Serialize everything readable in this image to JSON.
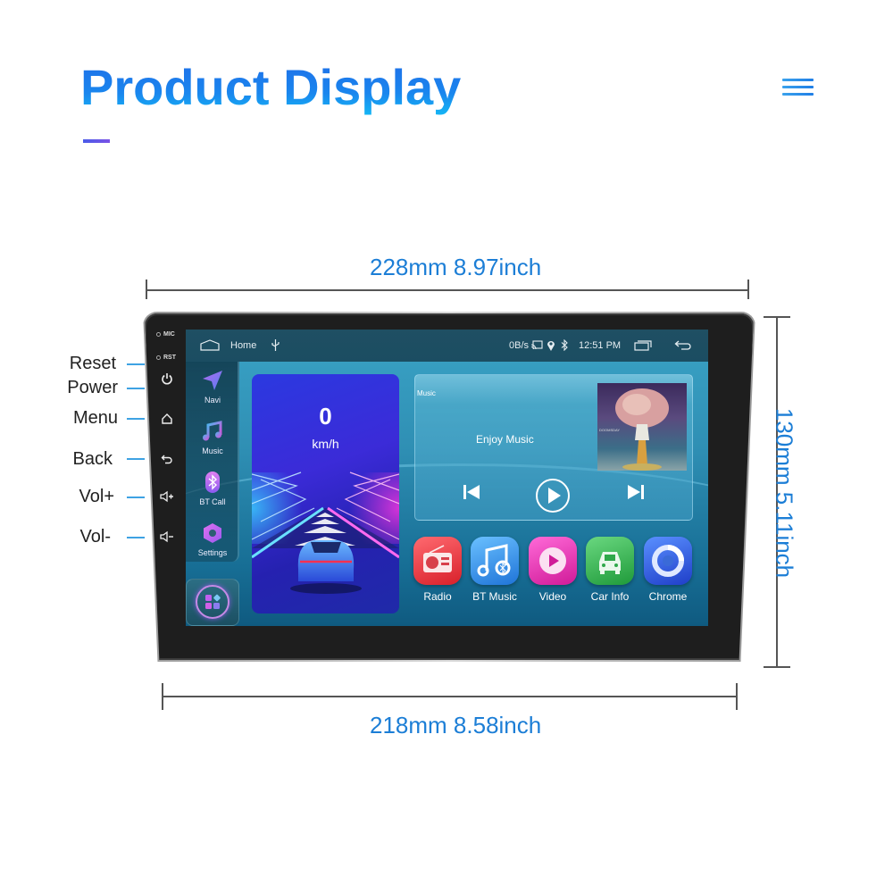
{
  "header": {
    "title": "Product Display",
    "menu_icon": "hamburger-menu-icon"
  },
  "dimensions": {
    "top_width": "228mm 8.97inch",
    "bottom_width": "218mm 8.58inch",
    "height": "130mm 5.11inch"
  },
  "hardware": {
    "mic_label": "MIC",
    "rst_label": "RST",
    "callouts": [
      {
        "label": "Reset",
        "icon": "reset-pinhole"
      },
      {
        "label": "Power",
        "icon": "power-icon"
      },
      {
        "label": "Menu",
        "icon": "home-icon"
      },
      {
        "label": "Back",
        "icon": "back-icon"
      },
      {
        "label": "Vol+",
        "icon": "volume-up-icon"
      },
      {
        "label": "Vol-",
        "icon": "volume-down-icon"
      }
    ]
  },
  "screen": {
    "statusbar": {
      "home_label": "Home",
      "net_speed": "0B/s",
      "time": "12:51 PM"
    },
    "dock": [
      {
        "label": "Navi",
        "icon": "navigation-icon"
      },
      {
        "label": "Music",
        "icon": "music-note-icon"
      },
      {
        "label": "BT Call",
        "icon": "bluetooth-icon"
      },
      {
        "label": "Settings",
        "icon": "settings-icon"
      }
    ],
    "speed": {
      "value": "0",
      "unit": "km/h"
    },
    "music": {
      "title": "Music",
      "song": "Enjoy Music",
      "album_text": "DOOMSDAY"
    },
    "apps": [
      {
        "label": "Radio",
        "color": "#e0323a"
      },
      {
        "label": "BT Music",
        "color": "#2f8fe0"
      },
      {
        "label": "Video",
        "color": "#e02aa8"
      },
      {
        "label": "Car Info",
        "color": "#2fa84a"
      },
      {
        "label": "Chrome",
        "color": "#2b5fd8"
      }
    ]
  }
}
